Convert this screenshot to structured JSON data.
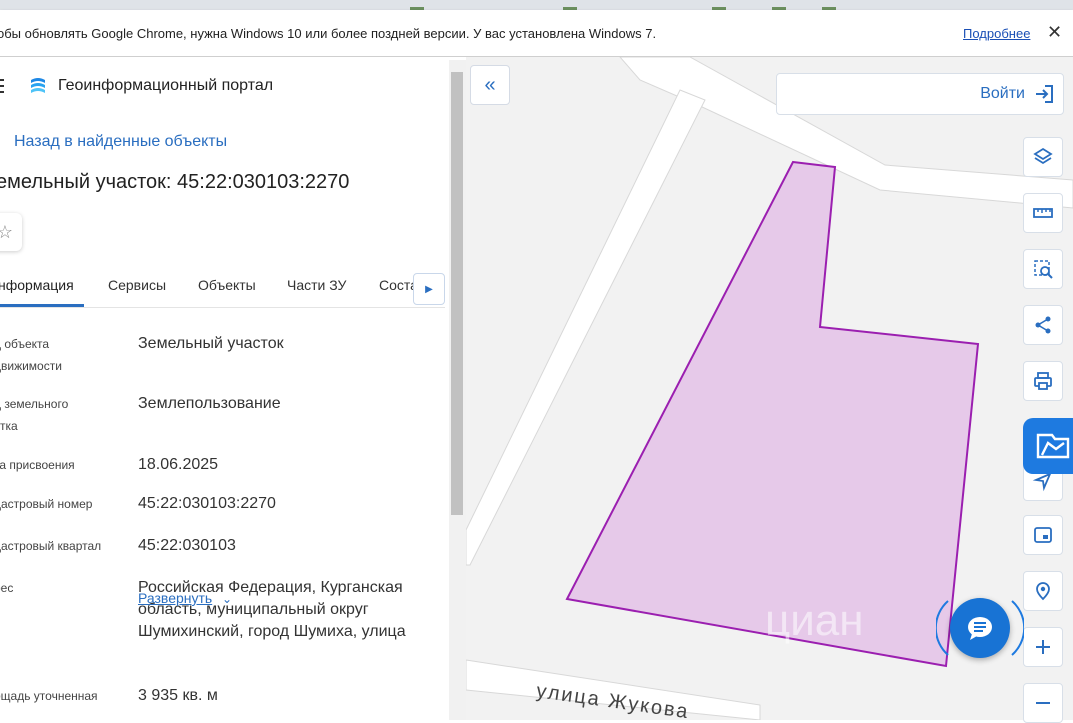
{
  "browser": {
    "infobar_message": "обы обновлять Google Chrome, нужна Windows 10 или более поздней версии. У вас установлена Windows 7.",
    "infobar_more": "Подробнее",
    "infobar_close": "✕"
  },
  "header": {
    "portal_title": "Геоинформационный портал"
  },
  "nav": {
    "back_label": "Назад в найденные объекты"
  },
  "object": {
    "title": "емельный участок: 45:22:030103:2270"
  },
  "tabs": [
    {
      "label": "нформация"
    },
    {
      "label": "Сервисы"
    },
    {
      "label": "Объекты"
    },
    {
      "label": "Части ЗУ"
    },
    {
      "label": "Соста"
    }
  ],
  "details": [
    {
      "label": "д объекта\nдвижимости",
      "value": "Земельный участок"
    },
    {
      "label": "д земельного\nстка",
      "value": "Землепользование"
    },
    {
      "label": "та присвоения",
      "value": "18.06.2025"
    },
    {
      "label": "дастровый номер",
      "value": "45:22:030103:2270"
    },
    {
      "label": "дастровый квартал",
      "value": "45:22:030103"
    },
    {
      "label": "рес",
      "value": "Российская Федерация, Курганская область, муниципальный округ Шумихинский, город Шумиха, улица"
    },
    {
      "label": "ощадь уточненная",
      "value": "3 935 кв. м"
    }
  ],
  "expand_label": "Развернуть",
  "map": {
    "login_label": "Войти",
    "street_label": "улица Жукова",
    "parcel_fill": "#e6c9e9",
    "parcel_stroke": "#9b1fb0",
    "accent": "#1e7ae0"
  },
  "toolbar_icons": [
    "layers-icon",
    "ruler-icon",
    "select-area-icon",
    "share-icon",
    "print-icon",
    "location-icon",
    "minimap-icon",
    "geo-search-icon",
    "zoom-in-icon",
    "zoom-out-icon"
  ]
}
